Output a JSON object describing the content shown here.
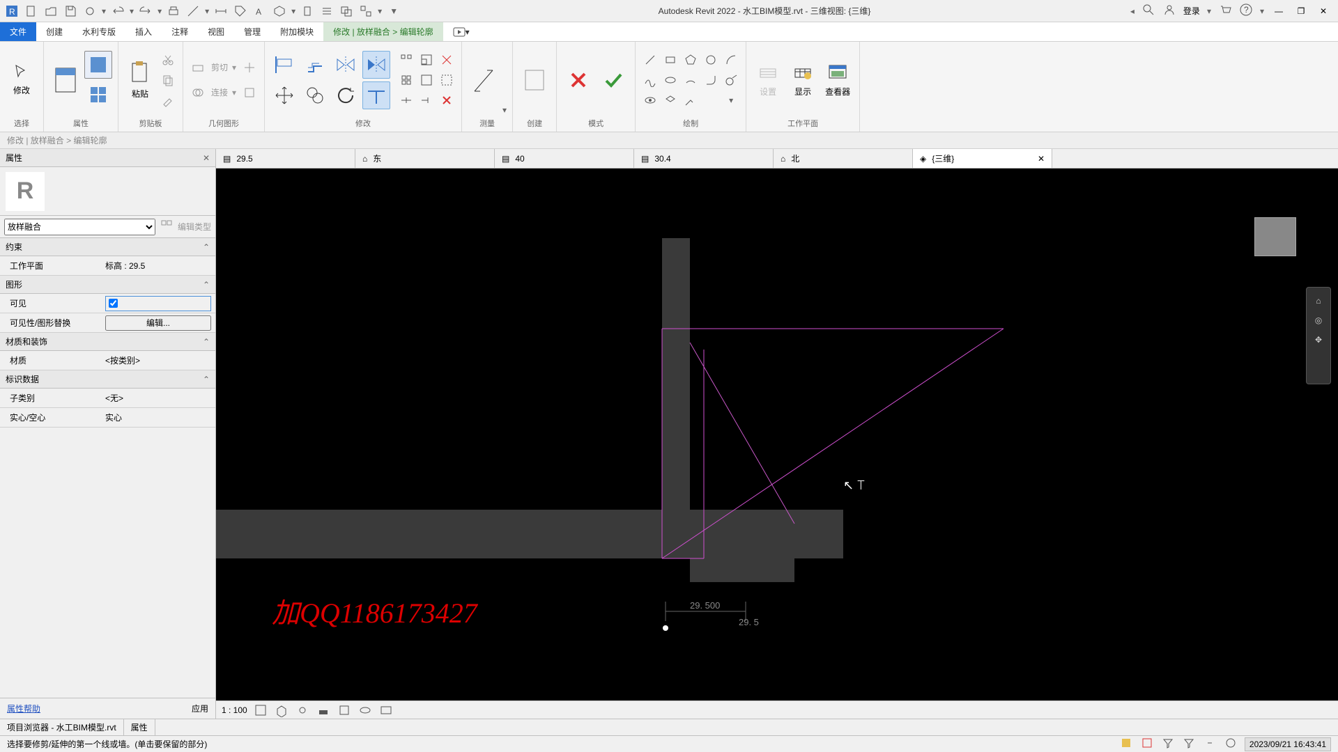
{
  "app": {
    "title": "Autodesk Revit 2022 - 水工BIM模型.rvt - 三维视图: {三维}",
    "login": "登录"
  },
  "menu": {
    "file": "文件",
    "create": "创建",
    "water": "水利专版",
    "insert": "插入",
    "annotate": "注释",
    "view": "视图",
    "manage": "管理",
    "addins": "附加模块",
    "modify": "修改 | 放样融合 > 编辑轮廓"
  },
  "ribbon": {
    "select": "选择",
    "modify_label": "修改",
    "properties": "属性",
    "clipboard": "剪贴板",
    "paste": "粘贴",
    "cut": "剪切",
    "join": "连接",
    "geometry": "几何图形",
    "modify": "修改",
    "measure": "测量",
    "create": "创建",
    "mode": "模式",
    "draw": "绘制",
    "workplane": "工作平面",
    "settings": "设置",
    "show": "显示",
    "viewer": "查看器"
  },
  "subbar": "修改 | 放样融合  >  编辑轮廓",
  "views": {
    "v1": "29.5",
    "v2": "东",
    "v3": "40",
    "v4": "30.4",
    "v5": "北",
    "v6": "{三维}"
  },
  "props": {
    "title": "属性",
    "type": "放样融合",
    "edit_type": "编辑类型",
    "cat_constraint": "约束",
    "workplane_k": "工作平面",
    "workplane_v": "标高 : 29.5",
    "cat_graphics": "图形",
    "visible_k": "可见",
    "visoverride_k": "可见性/图形替换",
    "visoverride_v": "编辑...",
    "cat_material": "材质和装饰",
    "material_k": "材质",
    "material_v": "<按类别>",
    "cat_identity": "标识数据",
    "subcat_k": "子类别",
    "subcat_v": "<无>",
    "solid_k": "实心/空心",
    "solid_v": "实心",
    "help": "属性帮助",
    "apply": "应用"
  },
  "canvas": {
    "dim1": "29. 500",
    "dim2": "29. 5",
    "wm": "加QQ1186173427",
    "scale": "1 : 100"
  },
  "bottom": {
    "browser": "项目浏览器 - 水工BIM模型.rvt",
    "props": "属性"
  },
  "status": {
    "hint": "选择要修剪/延伸的第一个线或墙。(单击要保留的部分)",
    "datetime": "2023/09/21 16:43:41"
  }
}
